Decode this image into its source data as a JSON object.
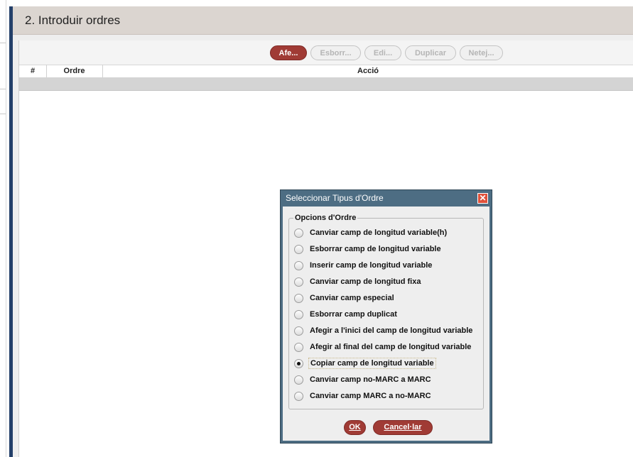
{
  "header": {
    "title": "2. Introduir ordres"
  },
  "toolbar": {
    "add": "Afe...",
    "delete": "Esborr...",
    "edit": "Edi...",
    "duplicate": "Duplicar",
    "clear": "Netej..."
  },
  "table": {
    "columns": [
      "#",
      "Ordre",
      "Acció"
    ]
  },
  "dialog": {
    "title": "Seleccionar Tipus d'Ordre",
    "close_icon": "close-icon",
    "group_label": "Opcions d'Ordre",
    "options": [
      {
        "label": "Canviar camp de longitud variable(h)",
        "checked": false
      },
      {
        "label": "Esborrar camp de longitud variable",
        "checked": false
      },
      {
        "label": "Inserir camp de longitud variable",
        "checked": false
      },
      {
        "label": "Canviar camp de longitud fixa",
        "checked": false
      },
      {
        "label": "Canviar camp especial",
        "checked": false
      },
      {
        "label": "Esborrar camp duplicat",
        "checked": false
      },
      {
        "label": "Afegir a l'inici del camp de longitud variable",
        "checked": false
      },
      {
        "label": "Afegir al final del camp de longitud variable",
        "checked": false
      },
      {
        "label": "Copiar camp de longitud variable",
        "checked": true
      },
      {
        "label": "Canviar camp no-MARC a MARC",
        "checked": false
      },
      {
        "label": "Canviar camp MARC a no-MARC",
        "checked": false
      }
    ],
    "ok": "OK",
    "cancel": "Cancel·lar"
  },
  "colors": {
    "accent_button": "#a03b35",
    "dialog_frame": "#4d6d83",
    "header_bar": "#dbd5d0",
    "left_accent": "#24406a"
  }
}
